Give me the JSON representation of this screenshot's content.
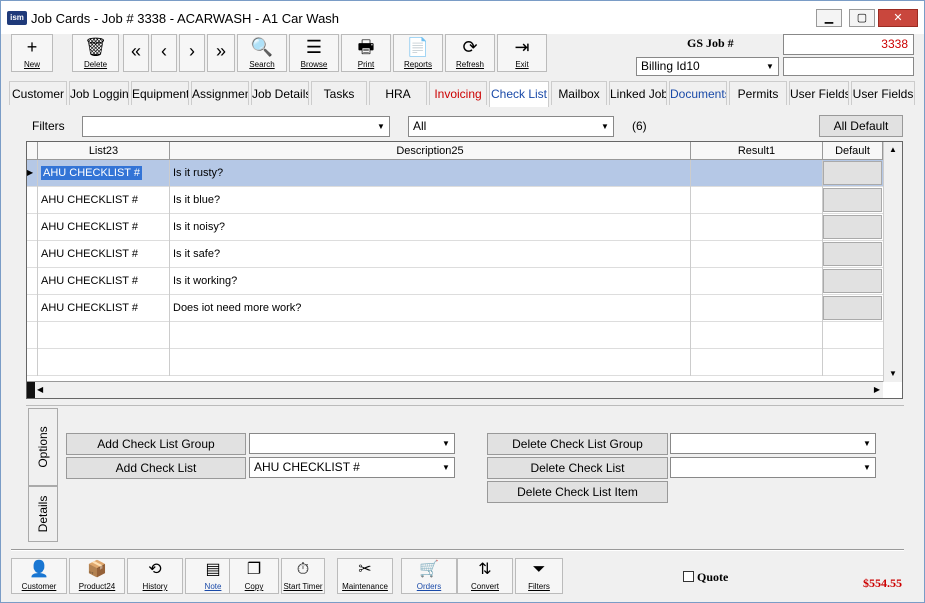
{
  "window": {
    "title": "Job Cards - Job # 3338 - ACARWASH - A1 Car Wash",
    "app_icon": "ism",
    "min": "▁",
    "max": "▢",
    "close": "✕"
  },
  "toolbar": [
    {
      "label": "New",
      "icon": "+"
    },
    {
      "label": "Delete",
      "icon": "🗑"
    },
    {
      "label": "",
      "icon": "«"
    },
    {
      "label": "",
      "icon": "‹"
    },
    {
      "label": "",
      "icon": "›"
    },
    {
      "label": "",
      "icon": "»"
    },
    {
      "label": "Search",
      "icon": "🔍"
    },
    {
      "label": "Browse",
      "icon": "☰"
    },
    {
      "label": "Print",
      "icon": "🖶"
    },
    {
      "label": "Reports",
      "icon": "📄"
    },
    {
      "label": "Refresh",
      "icon": "⟳"
    },
    {
      "label": "Exit",
      "icon": "⇥"
    }
  ],
  "header": {
    "gs_job_label": "GS Job  #",
    "job_number": "3338",
    "billing": "Billing Id10",
    "job_color": "#cc0000"
  },
  "tabs": [
    {
      "label": "Customer",
      "color": "#000000"
    },
    {
      "label": "Job Logging",
      "color": "#000000"
    },
    {
      "label": "Equipment",
      "color": "#000000"
    },
    {
      "label": "Assignments",
      "color": "#000000"
    },
    {
      "label": "Job Details",
      "color": "#000000"
    },
    {
      "label": "Tasks",
      "color": "#000000"
    },
    {
      "label": "HRA",
      "color": "#000000"
    },
    {
      "label": "Invoicing",
      "color": "#cc0000"
    },
    {
      "label": "Check List",
      "color": "#1a4aa8"
    },
    {
      "label": "Mailbox",
      "color": "#000000"
    },
    {
      "label": "Linked Jobs",
      "color": "#000000"
    },
    {
      "label": "Documents",
      "color": "#1a4aa8"
    },
    {
      "label": "Permits",
      "color": "#000000"
    },
    {
      "label": "User Fields",
      "color": "#000000"
    },
    {
      "label": "User Fields",
      "color": "#000000"
    }
  ],
  "filters": {
    "label": "Filters",
    "filter1": "",
    "filter2": "All",
    "count": "(6)",
    "all_default": "All Default"
  },
  "grid": {
    "columns": [
      "List23",
      "Description25",
      "Result1",
      "Default"
    ],
    "rows": [
      {
        "list": "AHU CHECKLIST #",
        "description": "Is it rusty?",
        "result": ""
      },
      {
        "list": "AHU CHECKLIST #",
        "description": "Is it blue?",
        "result": ""
      },
      {
        "list": "AHU CHECKLIST #",
        "description": "Is it noisy?",
        "result": ""
      },
      {
        "list": "AHU CHECKLIST #",
        "description": "Is it safe?",
        "result": ""
      },
      {
        "list": "AHU CHECKLIST #",
        "description": "Is it working?",
        "result": ""
      },
      {
        "list": "AHU CHECKLIST #",
        "description": "Does iot need more work?",
        "result": ""
      }
    ]
  },
  "side_tabs": {
    "options": "Options",
    "details": "Details"
  },
  "actions": {
    "add_group": "Add Check List Group",
    "add_list": "Add Check List",
    "add_list_value": "AHU CHECKLIST #",
    "del_group": "Delete Check List Group",
    "del_list": "Delete Check List",
    "del_item": "Delete Check List Item"
  },
  "bottom": [
    {
      "label": "Customer",
      "icon": "👤",
      "color": "#000000"
    },
    {
      "label": "Product24",
      "icon": "📦",
      "color": "#000000"
    },
    {
      "label": "History",
      "icon": "⟲",
      "color": "#000000"
    },
    {
      "label": "Note",
      "icon": "▤",
      "color": "#1a4aa8"
    },
    {
      "label": "Copy",
      "icon": "❐",
      "color": "#000000"
    },
    {
      "label": "Start Timer",
      "icon": "⏱",
      "color": "#000000"
    },
    {
      "label": "Maintenance",
      "icon": "✂",
      "color": "#000000"
    },
    {
      "label": "Orders",
      "icon": "🛒",
      "color": "#1a4aa8"
    },
    {
      "label": "Convert",
      "icon": "⇅",
      "color": "#000000"
    },
    {
      "label": "Filters",
      "icon": "⏷",
      "color": "#000000"
    }
  ],
  "quote_label": "Quote",
  "total": "$554.55"
}
